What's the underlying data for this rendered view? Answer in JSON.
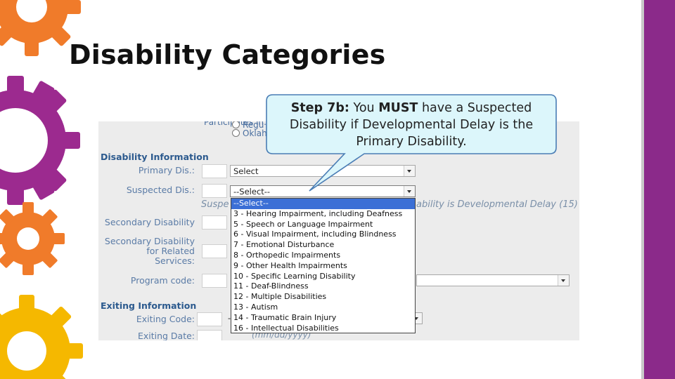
{
  "slide": {
    "title": "Disability Categories",
    "colors": {
      "accent_purple": "#8b2a8a",
      "gear_orange": "#f07b2a",
      "gear_yellow": "#f5b800",
      "gear_purple": "#9c2a8f",
      "callout_fill": "#dcf6fb",
      "callout_border": "#4a7db5",
      "highlight": "#3b6fd6"
    }
  },
  "callout": {
    "step": "Step 7b:",
    "pre": "You",
    "must": "MUST",
    "post": "have a Suspected Disability if Developmental Delay is the Primary Disability."
  },
  "form": {
    "participates_label": "Participates in:",
    "radio_1": "Regu",
    "radio_2": "Oklah",
    "disability_section": "Disability Information",
    "primary_label": "Primary Dis.:",
    "primary_value": "Select",
    "suspected_label": "Suspected Dis.:",
    "suspected_value": "--Select--",
    "suspected_note_left": "Suspe",
    "suspected_note_right": "ability is Developmental Delay (15)",
    "secondary_label": "Secondary Disability",
    "secondary_related_label_1": "Secondary Disability",
    "secondary_related_label_2": "for Related",
    "secondary_related_label_3": "Services:",
    "program_code_label": "Program code:",
    "exiting_section": "Exiting Information",
    "exiting_code_label": "Exiting Code:",
    "exiting_code_value": "-",
    "exiting_date_label": "Exiting Date:",
    "exiting_date_hint": "(mm/dd/yyyy)"
  },
  "dropdown": {
    "items": [
      "--Select--",
      "3 - Hearing Impairment, including Deafness",
      "5 - Speech or Language Impairment",
      "6 - Visual Impairment, including Blindness",
      "7 - Emotional Disturbance",
      "8 - Orthopedic Impairments",
      "9 - Other Health Impairments",
      "10 - Specific Learning Disability",
      "11 - Deaf-Blindness",
      "12 - Multiple Disabilities",
      "13 - Autism",
      "14 - Traumatic Brain Injury",
      "16 - Intellectual Disabilities"
    ],
    "highlighted_index": 0
  }
}
